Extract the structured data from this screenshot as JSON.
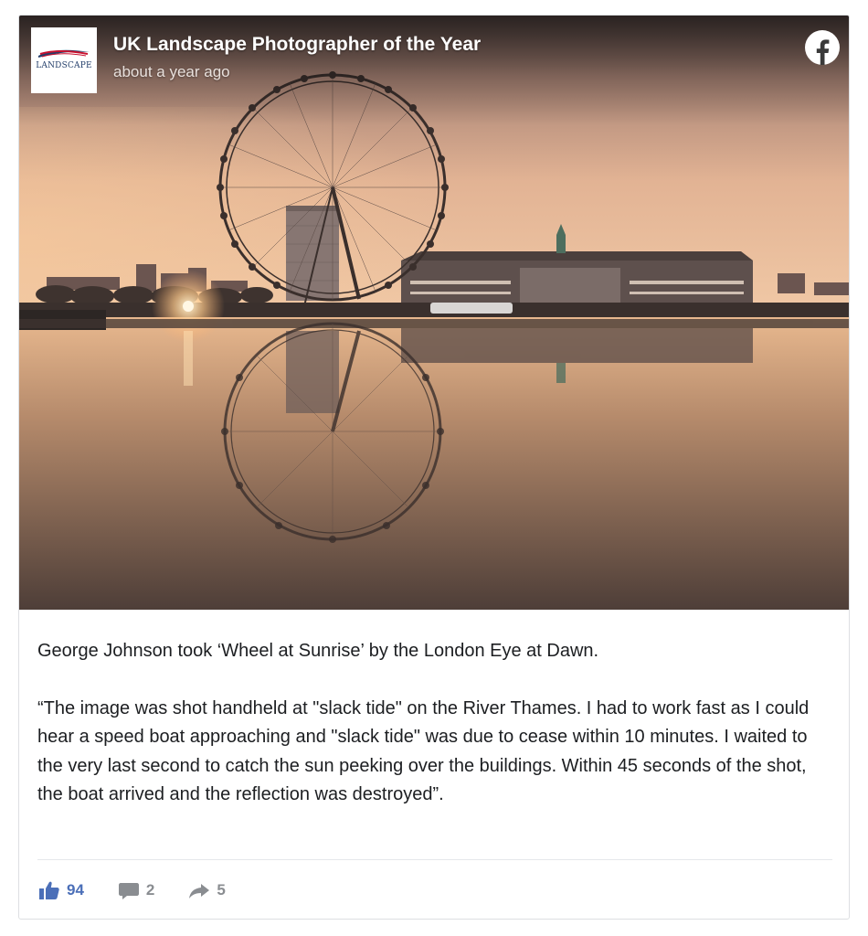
{
  "post": {
    "page_name": "UK Landscape Photographer of the Year",
    "timestamp": "about a year ago",
    "avatar_logo_text": "LANDSCAPE",
    "platform_icon": "facebook-icon",
    "caption_line": "George Johnson took ‘Wheel at Sunrise’ by the London Eye at Dawn.",
    "quote": "“The image was shot handheld at \"slack tide\" on the River Thames. I had to work fast as I could hear a speed boat approaching and \"slack tide\" was due to cease within 10 minutes. I waited to the very last second to catch the sun peeking over the buildings. Within 45 seconds of the shot, the boat arrived and the reflection was destroyed”."
  },
  "stats": {
    "likes": "94",
    "comments": "2",
    "shares": "5"
  },
  "icons": {
    "like": "thumbs-up-icon",
    "comment": "comment-icon",
    "share": "share-arrow-icon"
  },
  "colors": {
    "facebook_blue": "#4b6fb8",
    "muted_gray": "#8a8d91",
    "text": "#1c1e21"
  }
}
